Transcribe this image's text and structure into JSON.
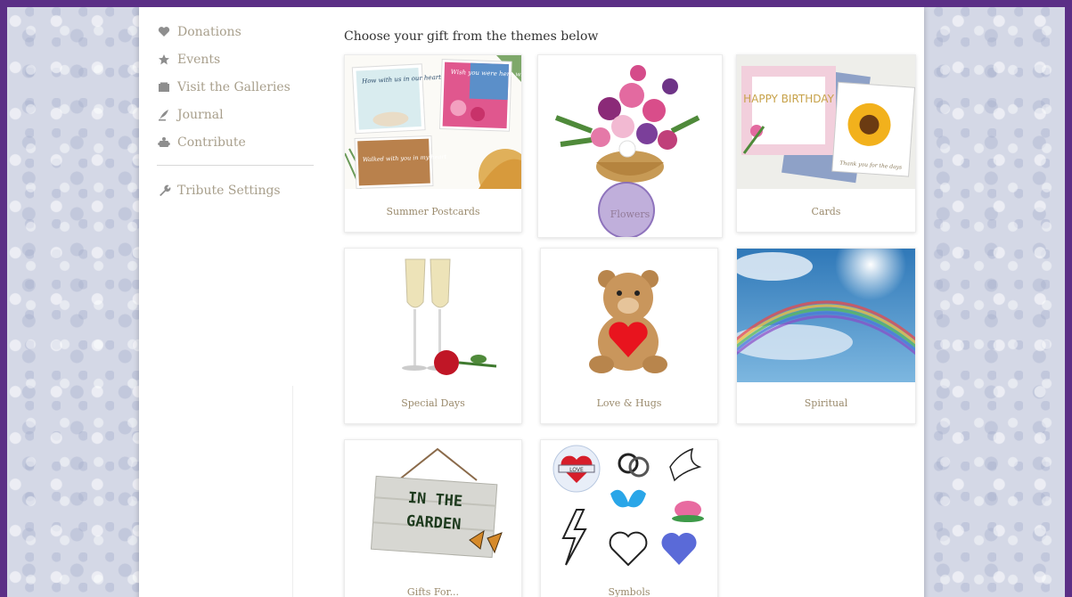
{
  "sidebar": {
    "items": [
      {
        "label": "Donations",
        "icon": "heart-icon"
      },
      {
        "label": "Events",
        "icon": "star-icon"
      },
      {
        "label": "Visit the Galleries",
        "icon": "gallery-icon"
      },
      {
        "label": "Journal",
        "icon": "quill-icon"
      },
      {
        "label": "Contribute",
        "icon": "puzzle-icon"
      }
    ],
    "settings": {
      "label": "Tribute Settings",
      "icon": "wrench-icon"
    }
  },
  "main": {
    "heading": "Choose your gift from the themes below",
    "themes": [
      {
        "label": "Summer Postcards"
      },
      {
        "label": "Flowers"
      },
      {
        "label": "Cards"
      },
      {
        "label": "Special Days"
      },
      {
        "label": "Love & Hugs"
      },
      {
        "label": "Spiritual"
      },
      {
        "label": "Gifts For..."
      },
      {
        "label": "Symbols"
      }
    ]
  },
  "artwork": {
    "postcard_1": "How with us in our hearts",
    "postcard_2": "Wish you were here with us",
    "postcard_3": "Walked with you in my heart",
    "birthday_card": "HAPPY BIRTHDAY",
    "thanks_card": "Thank you for the days",
    "garden_sign_line1": "IN THE",
    "garden_sign_line2": "GARDEN",
    "symbol_heart_banner": "LOVE"
  },
  "colors": {
    "frame": "#5b2f86",
    "label": "#9a8a6c",
    "sidebar_text": "#a89f8c",
    "tap_indicator": "#8c6ebe"
  }
}
